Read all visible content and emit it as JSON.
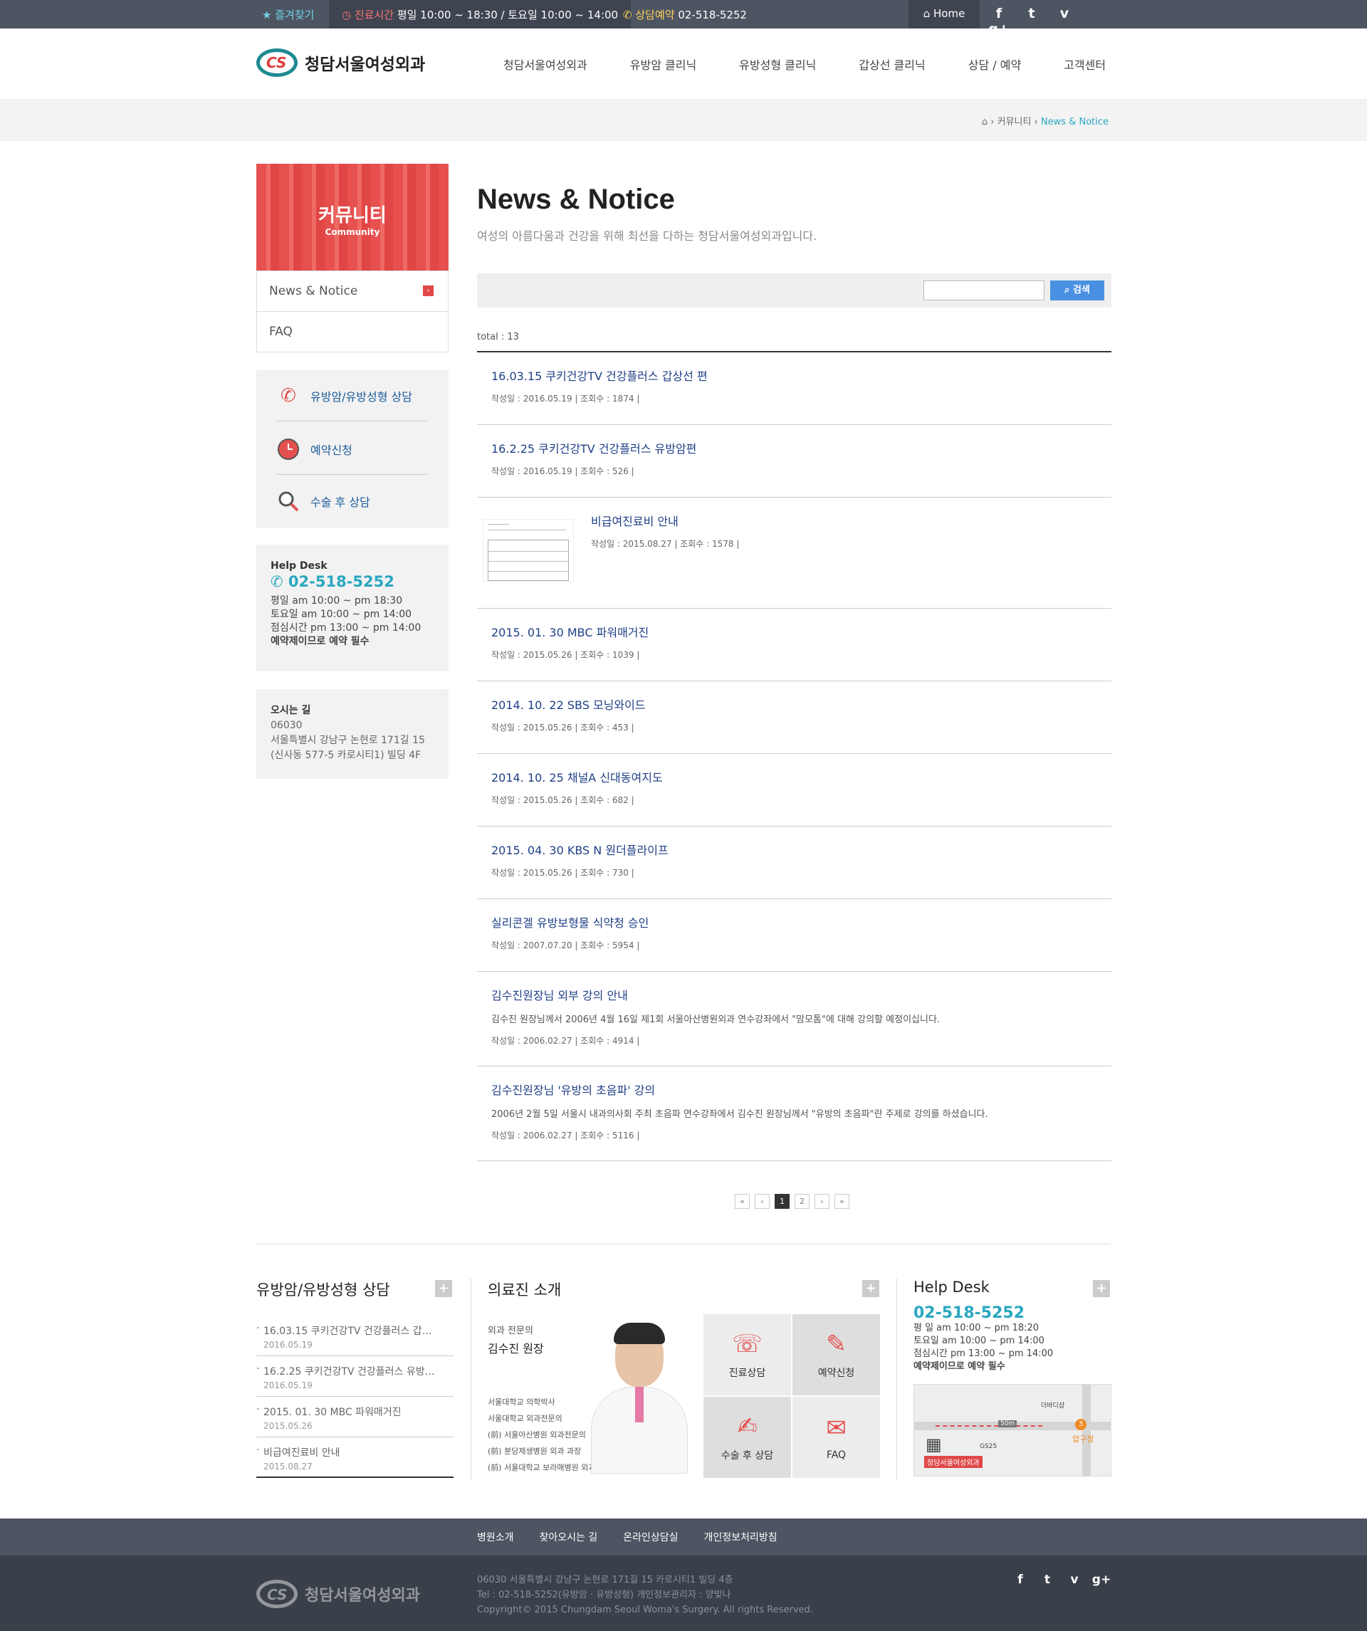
{
  "topbar": {
    "favorite": "★ 즐겨찾기",
    "hours_label": "진료시간",
    "hours_value": "평일 10:00 ~ 18:30 / 토요일 10:00 ~ 14:00",
    "consult_label": "상담예약",
    "consult_phone": "02-518-5252",
    "home": "Home",
    "social": [
      "f",
      "t",
      "v",
      "g+"
    ]
  },
  "header": {
    "logo_mark": "CS",
    "logo_name": "청담서울여성외과",
    "nav": [
      "청담서울여성외과",
      "유방암 클리닉",
      "유방성형 클리닉",
      "갑상선 클리닉",
      "상담 / 예약",
      "고객센터"
    ]
  },
  "breadcrumb": {
    "level1": "커뮤니티",
    "current": "News & Notice"
  },
  "sidebar": {
    "title": "커뮤니티",
    "subtitle": "Community",
    "menu": [
      "News & Notice",
      "FAQ"
    ],
    "quick": [
      "유방암/유방성형 상담",
      "예약신청",
      "수술 후 상담"
    ],
    "help": {
      "title": "Help Desk",
      "phone": "02-518-5252",
      "lines": [
        "평일 am 10:00 ~ pm 18:30",
        "토요일 am 10:00 ~ pm 14:00",
        "점심시간 pm 13:00 ~ pm 14:00"
      ],
      "note": "예약제이므로 예약 필수"
    },
    "location": {
      "title": "오시는 길",
      "zip": "06030",
      "addr1": "서울특별시 강남구 논현로 171길 15",
      "addr2": "(신사동 577-5 카로시티1) 빌딩 4F"
    }
  },
  "main": {
    "title": "News & Notice",
    "subtitle": "여성의 아름다움과 건강을 위해 최선을 다하는 청담서울여성외과입니다.",
    "search_button": "검색",
    "total": "total : 13",
    "posts": [
      {
        "title": "16.03.15 쿠키건강TV 건강플러스 갑상선 편",
        "desc": "",
        "meta": "작성일 : 2016.05.19  |  조회수 : 1874  |"
      },
      {
        "title": "16.2.25 쿠키건강TV 건강플러스 유방암편",
        "desc": "",
        "meta": "작성일 : 2016.05.19  |  조회수 : 526  |"
      },
      {
        "title": "비급여진료비 안내",
        "desc": "",
        "meta": "작성일 : 2015.08.27  |  조회수 : 1578  |",
        "thumb": true
      },
      {
        "title": "2015. 01. 30 MBC 파워매거진",
        "desc": "",
        "meta": "작성일 : 2015.05.26  |  조회수 : 1039  |"
      },
      {
        "title": "2014. 10. 22 SBS 모닝와이드",
        "desc": "",
        "meta": "작성일 : 2015.05.26  |  조회수 : 453  |"
      },
      {
        "title": "2014. 10. 25 채널A 신대동여지도",
        "desc": "",
        "meta": "작성일 : 2015.05.26  |  조회수 : 682  |"
      },
      {
        "title": "2015. 04. 30 KBS N 원더플라이프",
        "desc": "",
        "meta": "작성일 : 2015.05.26  |  조회수 : 730  |"
      },
      {
        "title": "실리콘겔 유방보형물 식약청 승인",
        "desc": "",
        "meta": "작성일 : 2007.07.20  |  조회수 : 5954  |"
      },
      {
        "title": "김수진원장님 외부 강의 안내",
        "desc": "김수진 원장님께서 2006년 4월 16일 제1회 서울아산병원외과 연수강좌에서 \"맘모톰\"에 대해 강의할 예정이십니다.",
        "meta": "작성일 : 2006.02.27  |  조회수 : 4914  |"
      },
      {
        "title": "김수진원장님 '유방의 초음파' 강의",
        "desc": "2006년 2월 5일 서울시 내과의사회 주최 초음파 연수강좌에서 김수진 원장님께서 \"유방의 초음파\"란 주제로 강의를 하셨습니다.",
        "meta": "작성일 : 2006.02.27  |  조회수 : 5116  |"
      }
    ],
    "pager": [
      "«",
      "‹",
      "1",
      "2",
      "›",
      "»"
    ]
  },
  "bottom": {
    "news": {
      "title": "유방암/유방성형 상담",
      "items": [
        {
          "text": "16.03.15 쿠키건강TV 건강플러스 갑…",
          "date": "2016.05.19"
        },
        {
          "text": "16.2.25 쿠키건강TV 건강플러스 유방…",
          "date": "2016.05.19"
        },
        {
          "text": "2015. 01. 30 MBC 파워매거진",
          "date": "2015.05.26"
        },
        {
          "text": "비급여진료비 안내",
          "date": "2015.08.27"
        }
      ]
    },
    "doctor": {
      "title": "의료진 소개",
      "spec": "외과 전문의",
      "name": "김수진 원장",
      "history": [
        "서울대학교 의학박사",
        "서울대학교 외과전문의",
        "(前) 서울아산병원 외과전문의",
        "(前) 분당제생병원 외과 과장",
        "(前) 서울대학교 보라매병원 외과 교수"
      ],
      "tiles": [
        "진료상담",
        "예약신청",
        "수술 후 상담",
        "FAQ"
      ]
    },
    "helpdesk": {
      "title": "Help Desk",
      "phone": "02-518-5252",
      "lines": [
        "평 일   am 10:00 ~ pm 18:20",
        "토요일   am 10:00 ~ pm 14:00",
        "점심시간   pm 13:00 ~ pm 14:00"
      ],
      "note": "예약제이므로 예약 필수",
      "map_labels": [
        "더바디샵",
        "50m",
        "압구정",
        "GS25",
        "청담서울여성외과"
      ],
      "map_badge": "3"
    }
  },
  "footer": {
    "links": [
      "병원소개",
      "찾아오시는 길",
      "온라인상담실",
      "개인정보처리방침"
    ],
    "logo_mark": "CS",
    "logo_name": "청담서울여성외과",
    "info": [
      "06030 서울특별시 강남구 논현로 171길 15 카로시티1 빌딩 4층",
      "Tel : 02-518-5252(유방암 · 유방성형)     개인정보관리자 : 양빛나",
      "Copyright© 2015 Chungdam Seoul Woma's Surgery. All rights Reserved."
    ],
    "social": [
      "f",
      "t",
      "v",
      "g+"
    ]
  }
}
